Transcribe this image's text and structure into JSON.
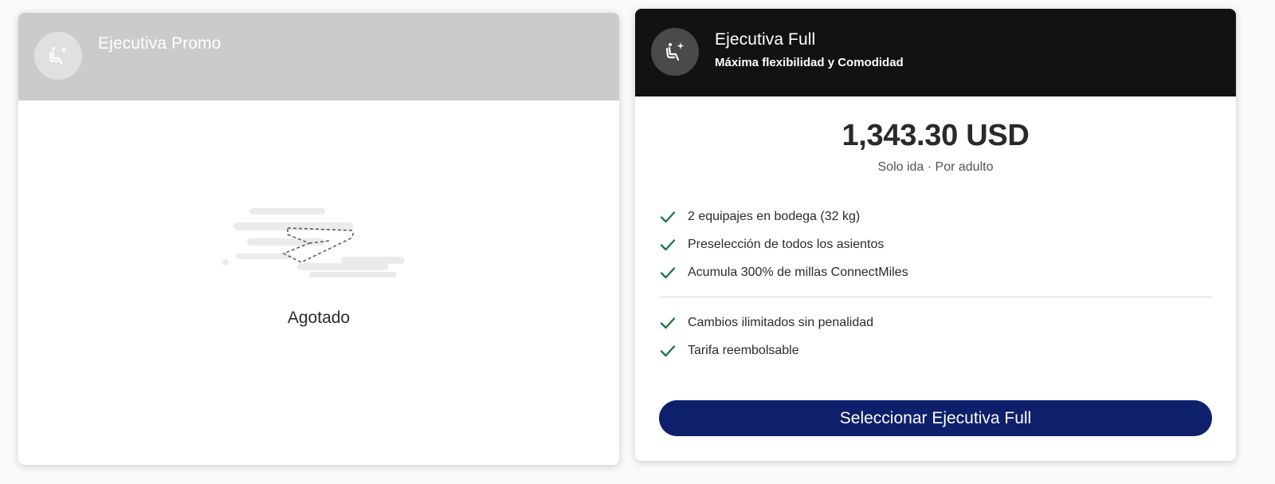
{
  "fare_promo": {
    "title": "Ejecutiva Promo",
    "status": "Agotado",
    "icon": "seat-sparkle-icon"
  },
  "fare_full": {
    "title": "Ejecutiva Full",
    "subtitle": "Máxima flexibilidad y Comodidad",
    "icon": "seat-sparkle-icon",
    "price": "1,343.30 USD",
    "price_note": "Solo ida · Por adulto",
    "benefits_group_1": [
      "2 equipajes en bodega (32 kg)",
      "Preselección de todos los asientos",
      "Acumula 300% de millas ConnectMiles"
    ],
    "benefits_group_2": [
      "Cambios ilimitados sin penalidad",
      "Tarifa reembolsable"
    ],
    "select_label": "Seleccionar Ejecutiva Full"
  },
  "colors": {
    "promo_header": "#cbcbcb",
    "full_header": "#121212",
    "check_green": "#1a7a47",
    "button_navy": "#0e1f6b"
  }
}
